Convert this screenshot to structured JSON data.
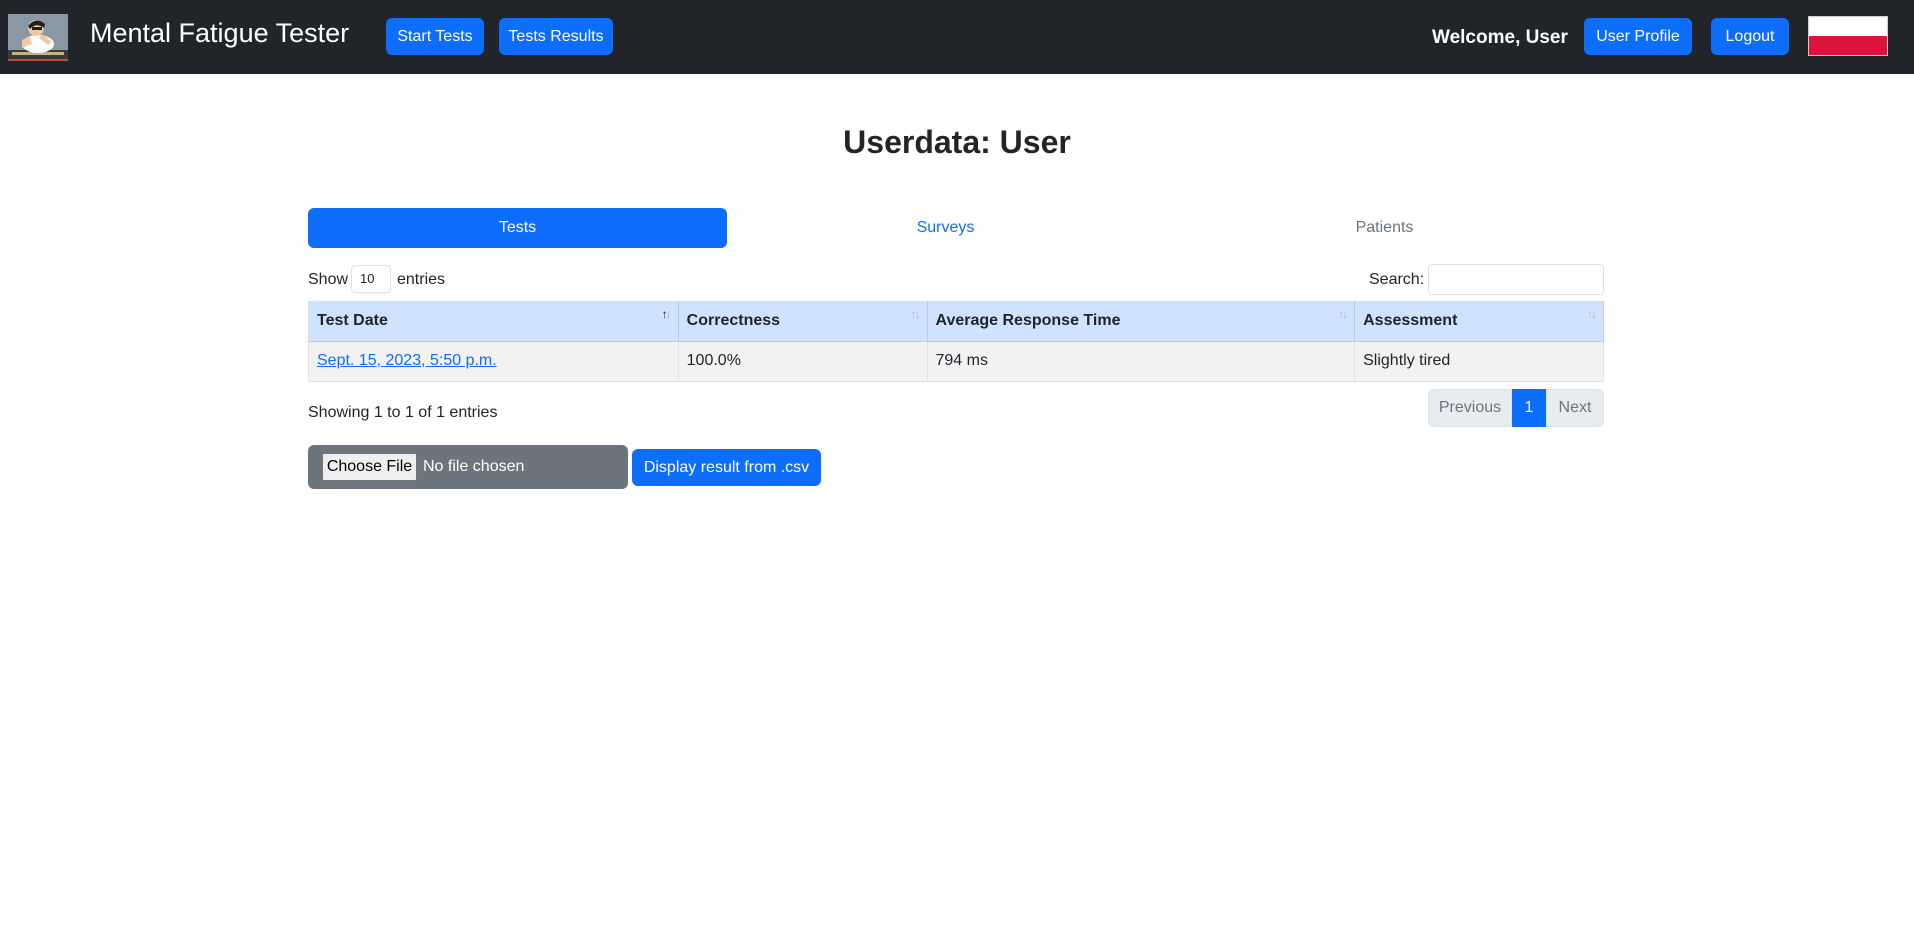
{
  "navbar": {
    "brand": "Mental Fatigue Tester",
    "start_tests": "Start Tests",
    "tests_results": "Tests Results",
    "welcome": "Welcome, User",
    "user_profile": "User Profile",
    "logout": "Logout",
    "logo_icon": "person-thinking-icon",
    "flag_icon": "poland-flag-icon",
    "colors": {
      "navbar_bg": "#212529",
      "primary": "#0d6efd"
    }
  },
  "page": {
    "title": "Userdata: User"
  },
  "tabs": [
    {
      "label": "Tests",
      "active": true
    },
    {
      "label": "Surveys",
      "active": false
    },
    {
      "label": "Patients",
      "active": false
    }
  ],
  "table_controls": {
    "show_label": "Show",
    "entries_value": "10",
    "entries_label": "entries",
    "search_label": "Search:",
    "search_value": ""
  },
  "table": {
    "columns": [
      "Test Date",
      "Correctness",
      "Average Response Time",
      "Assessment"
    ],
    "sorted_column": "Test Date",
    "rows": [
      [
        "Sept. 15, 2023, 5:50 p.m.",
        "100.0%",
        "794 ms",
        "Slightly tired"
      ]
    ],
    "header_bg": "#cfe2ff",
    "sort_icon": "sort-arrows-icon"
  },
  "pagination": {
    "info": "Showing 1 to 1 of 1 entries",
    "previous": "Previous",
    "current_page": "1",
    "next": "Next"
  },
  "upload": {
    "choose_file": "Choose File",
    "no_file": "No file chosen",
    "display_button": "Display result from .csv"
  }
}
